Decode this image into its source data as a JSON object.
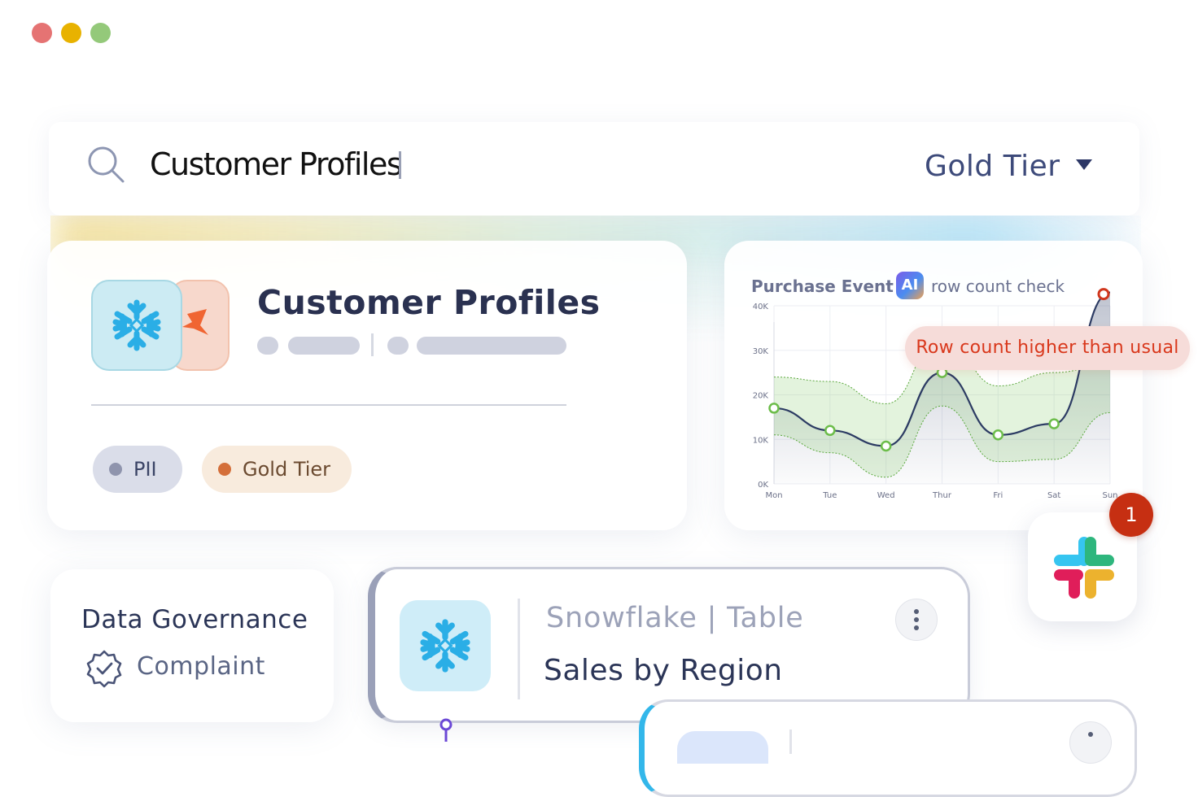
{
  "window": {
    "controls": [
      {
        "name": "close",
        "color": "#e57373"
      },
      {
        "name": "minimize",
        "color": "#e8b200"
      },
      {
        "name": "maximize",
        "color": "#94c97a"
      }
    ]
  },
  "search": {
    "query": "Customer Profiles",
    "filter_value": "Gold Tier"
  },
  "profile_card": {
    "title": "Customer Profiles",
    "source_icon": "snowflake-icon",
    "secondary_icon": "dbt-icon",
    "tags": [
      {
        "label": "PII",
        "dot_color": "#8f94ad",
        "bg": "#dadde9",
        "text_color": "#3b4466"
      },
      {
        "label": "Gold Tier",
        "dot_color": "#d46f3a",
        "bg": "#f8ebdd",
        "text_color": "#6b4a30"
      }
    ]
  },
  "chart_card": {
    "heading": "Purchase Event",
    "ai_badge": "AI",
    "subheading": "row count check",
    "alert": "Row count higher than usual"
  },
  "chart_data": {
    "type": "line",
    "categories": [
      "Mon",
      "Tue",
      "Wed",
      "Thur",
      "Fri",
      "Sat",
      "Sun"
    ],
    "series": [
      {
        "values": [
          17000,
          12000,
          8500,
          25000,
          11000,
          13500,
          43000
        ]
      }
    ],
    "expected_band": {
      "upper": [
        24000,
        23000,
        18000,
        33000,
        22000,
        25000,
        27000
      ],
      "lower": [
        11000,
        7000,
        1500,
        17500,
        5000,
        5500,
        16000
      ]
    },
    "anomaly_index": 6,
    "y_ticks": [
      "0K",
      "10K",
      "20K",
      "30K",
      "40K"
    ],
    "ylim": [
      0,
      40000
    ],
    "colors": {
      "line": "#2c3b63",
      "point": "#6cbd4a",
      "anomaly": "#d0361d",
      "band": "#7ec862"
    }
  },
  "slack": {
    "icon": "slack-icon",
    "notification_count": "1"
  },
  "governance_card": {
    "title": "Data Governance",
    "status": "Complaint",
    "status_icon": "verified-badge-icon"
  },
  "table_card": {
    "source": "Snowflake |  Table",
    "name": "Sales by Region",
    "icon": "snowflake-icon",
    "menu_icon": "kebab-menu-icon"
  }
}
